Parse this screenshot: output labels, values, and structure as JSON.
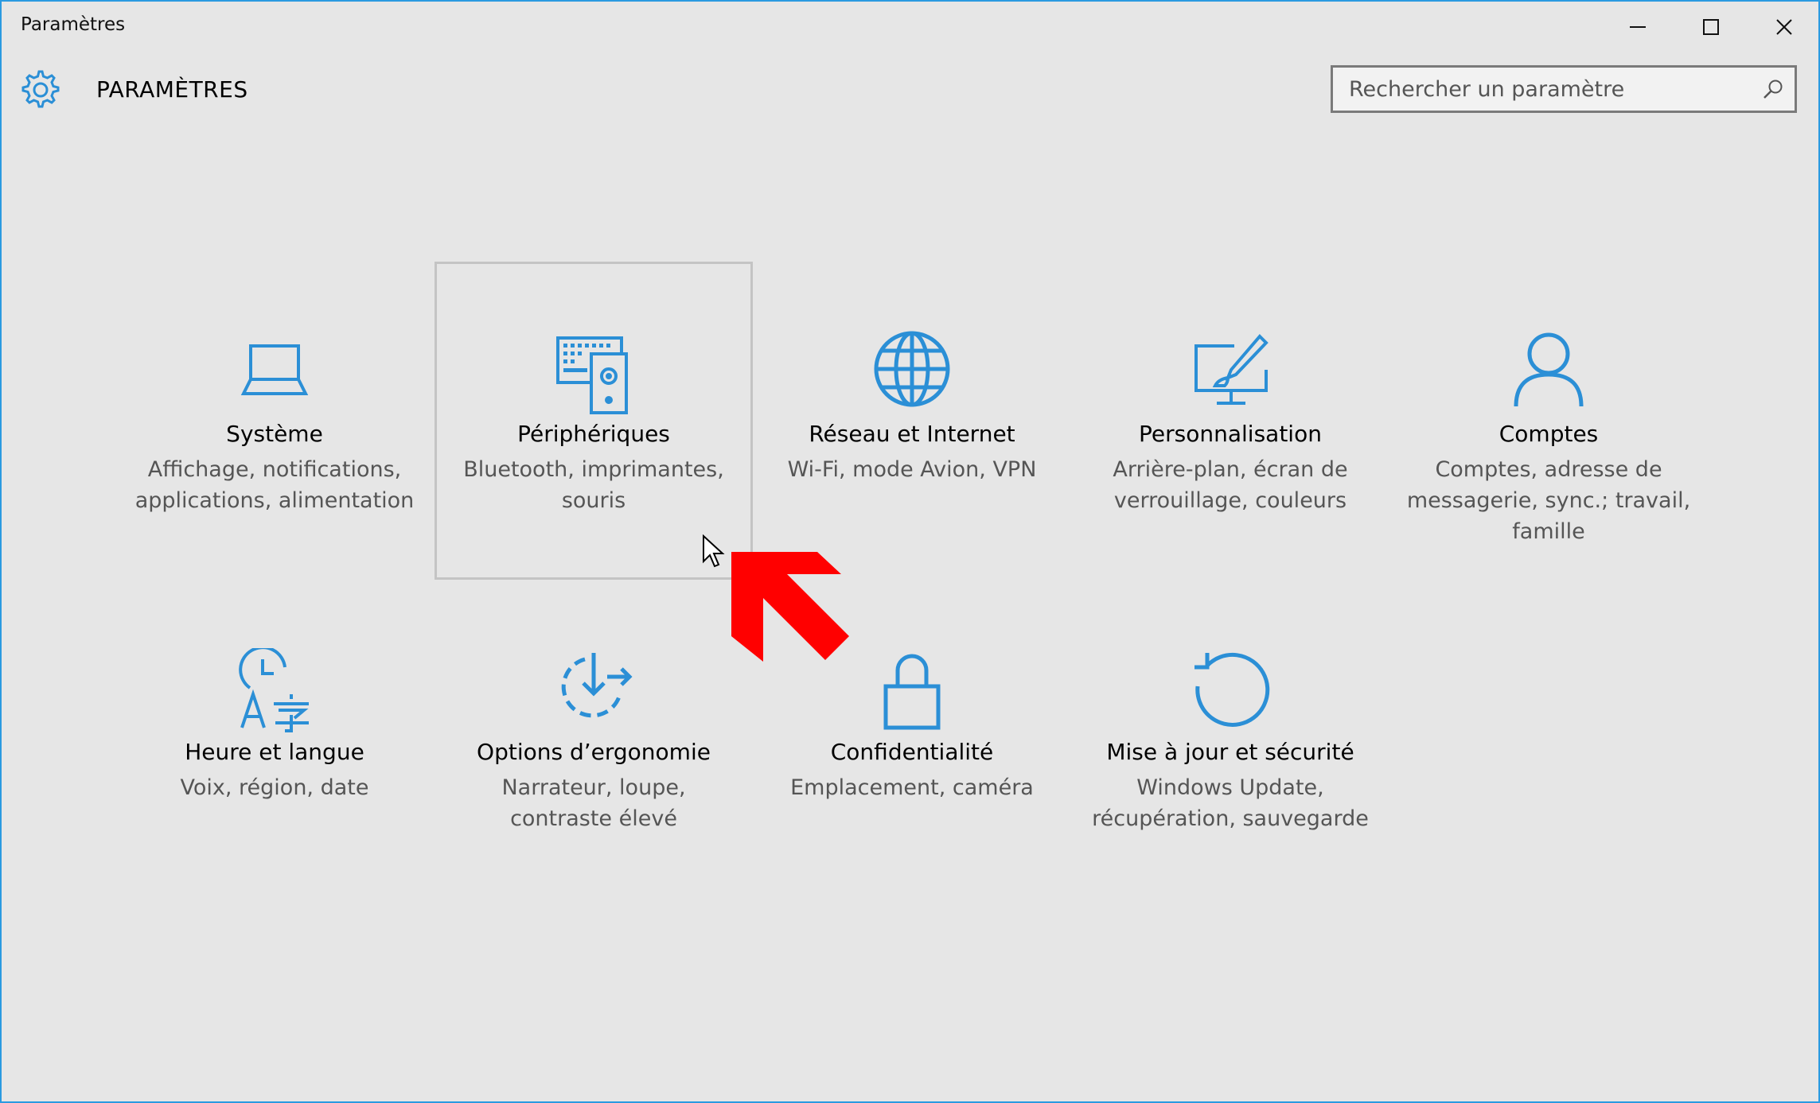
{
  "window": {
    "title": "Paramètres"
  },
  "header": {
    "title": "PARAMÈTRES",
    "icon": "gear-icon"
  },
  "search": {
    "placeholder": "Rechercher un paramètre",
    "value": ""
  },
  "colors": {
    "accent": "#2b8fd6",
    "background": "#e6e6e6",
    "arrow": "#ff0000"
  },
  "tiles": [
    {
      "title": "Système",
      "description": "Affichage, notifications, applications, alimentation",
      "icon": "laptop-icon"
    },
    {
      "title": "Périphériques",
      "description": "Bluetooth, imprimantes, souris",
      "icon": "devices-icon"
    },
    {
      "title": "Réseau et Internet",
      "description": "Wi-Fi, mode Avion, VPN",
      "icon": "globe-icon"
    },
    {
      "title": "Personnalisation",
      "description": "Arrière-plan, écran de verrouillage, couleurs",
      "icon": "paint-brush-icon"
    },
    {
      "title": "Comptes",
      "description": "Comptes, adresse de messagerie, sync.; travail, famille",
      "icon": "person-icon"
    },
    {
      "title": "Heure et langue",
      "description": "Voix, région, date",
      "icon": "time-language-icon"
    },
    {
      "title": "Options d’ergonomie",
      "description": "Narrateur, loupe, contraste élevé",
      "icon": "ease-of-access-icon"
    },
    {
      "title": "Confidentialité",
      "description": "Emplacement, caméra",
      "icon": "lock-icon"
    },
    {
      "title": "Mise à jour et sécurité",
      "description": "Windows Update, récupération, sauvegarde",
      "icon": "update-icon"
    }
  ]
}
